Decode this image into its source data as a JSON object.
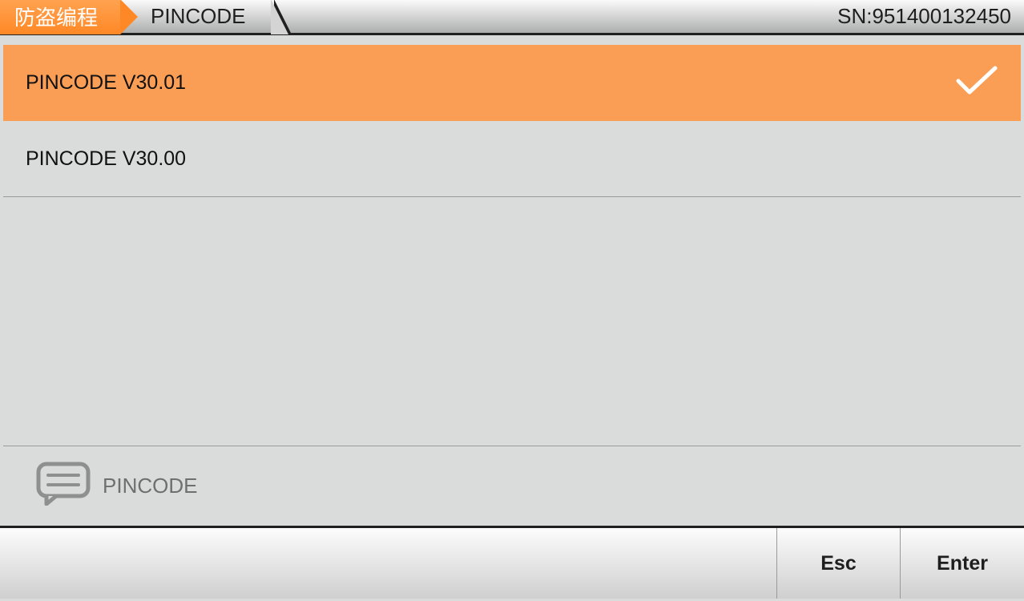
{
  "header": {
    "tab_a": "防盗编程",
    "tab_b": "PINCODE",
    "sn": "SN:951400132450"
  },
  "list": {
    "items": [
      {
        "label": "PINCODE V30.01",
        "selected": true
      },
      {
        "label": "PINCODE V30.00",
        "selected": false
      }
    ]
  },
  "notes": {
    "label": "PINCODE"
  },
  "footer": {
    "esc": "Esc",
    "enter": "Enter"
  }
}
